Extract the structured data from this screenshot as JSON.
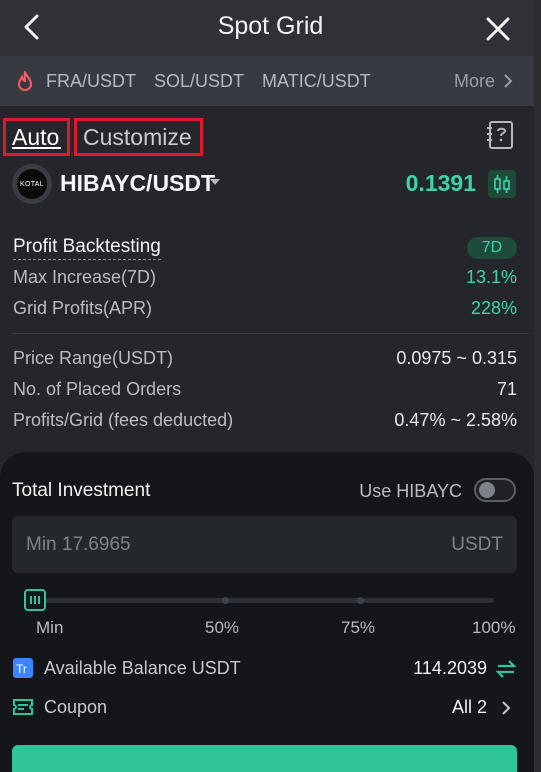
{
  "header": {
    "title": "Spot Grid",
    "back_icon": "chevron-left-icon",
    "close_icon": "close-icon"
  },
  "pairs": {
    "hot_icon": "fire-icon",
    "items": [
      "FRA/USDT",
      "SOL/USDT",
      "MATIC/USDT"
    ],
    "more_label": "More"
  },
  "modes": {
    "auto_label": "Auto",
    "customize_label": "Customize",
    "guide_icon": "guide-icon"
  },
  "pair": {
    "logo_text": "KOTAL",
    "name": "HIBAYC/USDT",
    "price": "0.1391"
  },
  "stats": {
    "backtest_label": "Profit Backtesting",
    "period_badge": "7D",
    "max_increase_label": "Max Increase(7D)",
    "max_increase_value": "13.1%",
    "grid_profits_label": "Grid Profits(APR)",
    "grid_profits_value": "228%",
    "price_range_label": "Price Range(USDT)",
    "price_range_value": "0.0975 ~ 0.315",
    "orders_label": "No. of Placed Orders",
    "orders_value": "71",
    "profit_grid_label": "Profits/Grid (fees deducted)",
    "profit_grid_value": "0.47% ~ 2.58%"
  },
  "investment": {
    "title": "Total Investment",
    "use_label": "Use HIBAYC",
    "use_toggle_on": false,
    "placeholder": "Min 17.6965",
    "unit": "USDT",
    "slider_level": 0,
    "slider_marks": [
      "Min",
      "50%",
      "75%",
      "100%"
    ]
  },
  "balance": {
    "label": "Available Balance USDT",
    "value": "114.2039"
  },
  "coupon": {
    "label": "Coupon",
    "value": "All 2"
  },
  "colors": {
    "accent": "#2fc596",
    "highlight_border": "#e0182d",
    "up": "#3dd5a8"
  }
}
